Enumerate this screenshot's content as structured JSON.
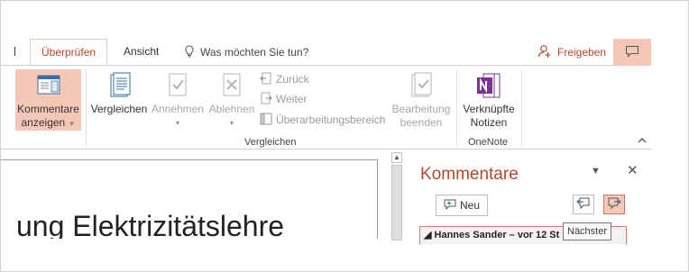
{
  "tabs": {
    "review": "Überprüfen",
    "view": "Ansicht",
    "tell_me": "Was möchten Sie tun?"
  },
  "share_label": "Freigeben",
  "ribbon": {
    "show_comments_line1": "Kommentare",
    "show_comments_line2": "anzeigen",
    "compare": "Vergleichen",
    "accept": "Annehmen",
    "reject": "Ablehnen",
    "previous": "Zurück",
    "next": "Weiter",
    "reviewing_pane": "Überarbeitungsbereich",
    "end_review_line1": "Bearbeitung",
    "end_review_line2": "beenden",
    "linked_notes_line1": "Verknüpfte",
    "linked_notes_line2": "Notizen",
    "group_compare": "Vergleichen",
    "group_onenote": "OneNote"
  },
  "document": {
    "visible_text": "ung Elektrizitätslehre"
  },
  "comments_pane": {
    "title": "Kommentare",
    "new_button": "Neu",
    "comment_author_strip": "◢ Hannes Sander – vor 12 St",
    "tooltip": "Nächster"
  },
  "colors": {
    "accent": "#b7472a",
    "selected_bg": "#f5c7b6",
    "onenote_purple": "#7b3294"
  }
}
